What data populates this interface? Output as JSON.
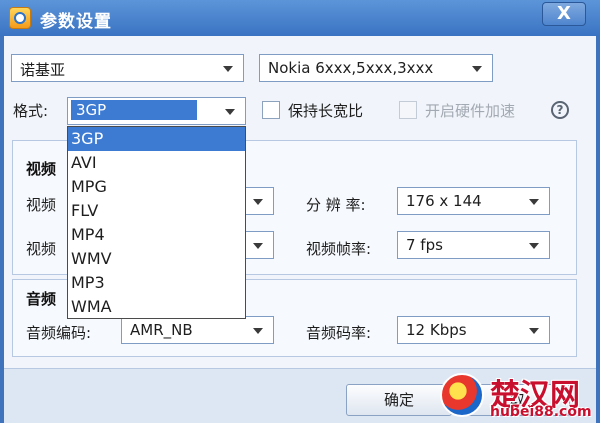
{
  "window": {
    "title": "参数设置",
    "close_label": "X",
    "icon": "app-icon"
  },
  "device": {
    "brand": "诺基亚",
    "model": "Nokia 6xxx,5xxx,3xxx"
  },
  "format": {
    "label": "格式:",
    "selected": "3GP",
    "options": [
      "3GP",
      "AVI",
      "MPG",
      "FLV",
      "MP4",
      "WMV",
      "MP3",
      "WMA"
    ]
  },
  "options": {
    "keep_aspect": {
      "label": "保持长宽比",
      "checked": false
    },
    "hw_accel": {
      "label": "开启硬件加速",
      "checked": false,
      "disabled": true
    },
    "help_symbol": "?"
  },
  "video": {
    "title": "视频",
    "codec_label": "视频",
    "bitrate_label": "视频",
    "resolution_label": "分 辨 率:",
    "resolution_value": "176 x 144",
    "framerate_label": "视频帧率:",
    "framerate_value": "7 fps"
  },
  "audio": {
    "title": "音频",
    "codec_label": "音频编码:",
    "codec_value": "AMR_NB",
    "bitrate_label": "音频码率:",
    "bitrate_value": "12 Kbps"
  },
  "footer": {
    "ok_label": "确定",
    "cancel_label": "取"
  },
  "watermark": {
    "text": "楚汉网",
    "url": "hubei88.com"
  },
  "colors": {
    "accent": "#3d7bd3",
    "titlebar": "#3a73c2"
  }
}
